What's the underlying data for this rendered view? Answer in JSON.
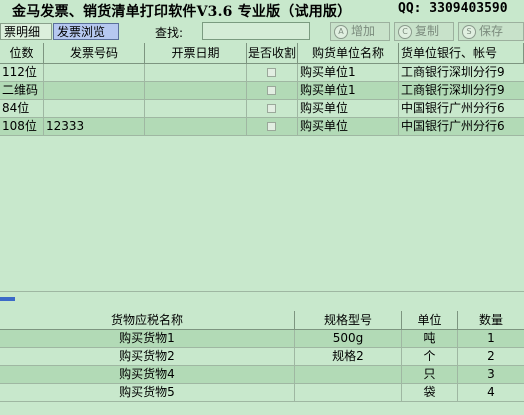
{
  "window": {
    "title": "金马发票、销货清单打印软件V3.6 专业版（试用版）",
    "qq": "QQ: 3309403590"
  },
  "toolbar": {
    "tabs": [
      "票明细",
      "发票浏览"
    ],
    "find_label": "查找:",
    "find_value": "",
    "buttons": [
      {
        "icon": "A",
        "label": "增加"
      },
      {
        "icon": "C",
        "label": "复制"
      },
      {
        "icon": "S",
        "label": "保存"
      }
    ]
  },
  "invoice_grid": {
    "headers": [
      "位数",
      "发票号码",
      "开票日期",
      "是否收割",
      "购货单位名称",
      "货单位银行、帐号"
    ],
    "rows": [
      {
        "digits": "112位",
        "number": "",
        "date": "",
        "buyer": "购买单位1",
        "bank": "工商银行深圳分行9"
      },
      {
        "digits": "二维码",
        "number": "",
        "date": "",
        "buyer": "购买单位1",
        "bank": "工商银行深圳分行9"
      },
      {
        "digits": "84位",
        "number": "",
        "date": "",
        "buyer": "购买单位",
        "bank": "中国银行广州分行6"
      },
      {
        "digits": "108位",
        "number": "12333",
        "date": "",
        "buyer": "购买单位",
        "bank": "中国银行广州分行6"
      }
    ]
  },
  "goods_grid": {
    "headers": [
      "货物应税名称",
      "规格型号",
      "单位",
      "数量"
    ],
    "rows": [
      {
        "name": "购买货物1",
        "spec": "500g",
        "unit": "吨",
        "qty": "1"
      },
      {
        "name": "购买货物2",
        "spec": "规格2",
        "unit": "个",
        "qty": "2"
      },
      {
        "name": "购买货物4",
        "spec": "",
        "unit": "只",
        "qty": "3"
      },
      {
        "name": "购买货物5",
        "spec": "",
        "unit": "袋",
        "qty": "4"
      }
    ]
  }
}
